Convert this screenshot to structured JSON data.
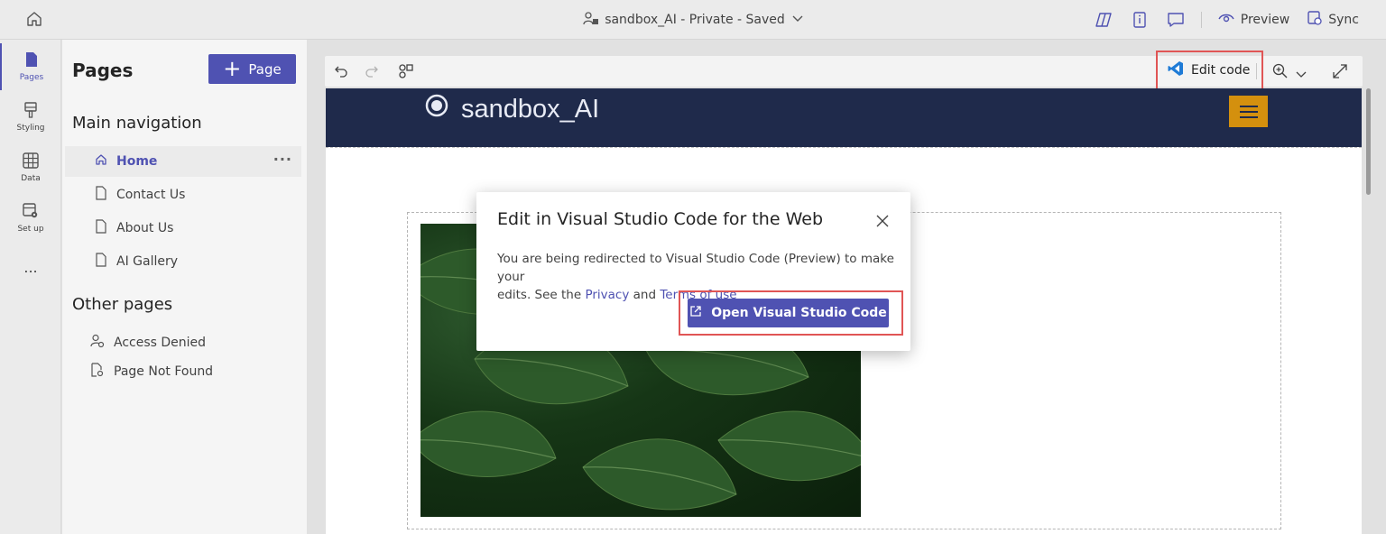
{
  "topbar": {
    "site_title": "sandbox_AI - Private - Saved",
    "preview_label": "Preview",
    "sync_label": "Sync"
  },
  "rail": {
    "items": [
      {
        "label": "Pages",
        "icon": "page-icon"
      },
      {
        "label": "Styling",
        "icon": "paintbrush-icon"
      },
      {
        "label": "Data",
        "icon": "table-icon"
      },
      {
        "label": "Set up",
        "icon": "settings-icon"
      }
    ],
    "more_label": "..."
  },
  "pages_panel": {
    "title": "Pages",
    "add_page_label": "Page",
    "main_nav_heading": "Main navigation",
    "main_nav_items": [
      "Home",
      "Contact Us",
      "About Us",
      "AI Gallery"
    ],
    "item_more": "···",
    "other_heading": "Other pages",
    "other_items": [
      "Access Denied",
      "Page Not Found"
    ]
  },
  "toolbar": {
    "edit_code_label": "Edit code"
  },
  "site": {
    "logo_text": "sandbox_AI"
  },
  "dialog": {
    "title": "Edit in Visual Studio Code for the Web",
    "body_line1": "You are being redirected to Visual Studio Code (Preview) to make your",
    "body_line2_prefix": "edits. See the ",
    "privacy_link": "Privacy",
    "and_text": " and ",
    "terms_link": "Terms of use",
    "open_button_label": "Open Visual Studio Code"
  },
  "colors": {
    "accent": "#4f52b2",
    "site_header": "#1f2a4b",
    "burger": "#d4900e",
    "highlight": "#e05555"
  }
}
